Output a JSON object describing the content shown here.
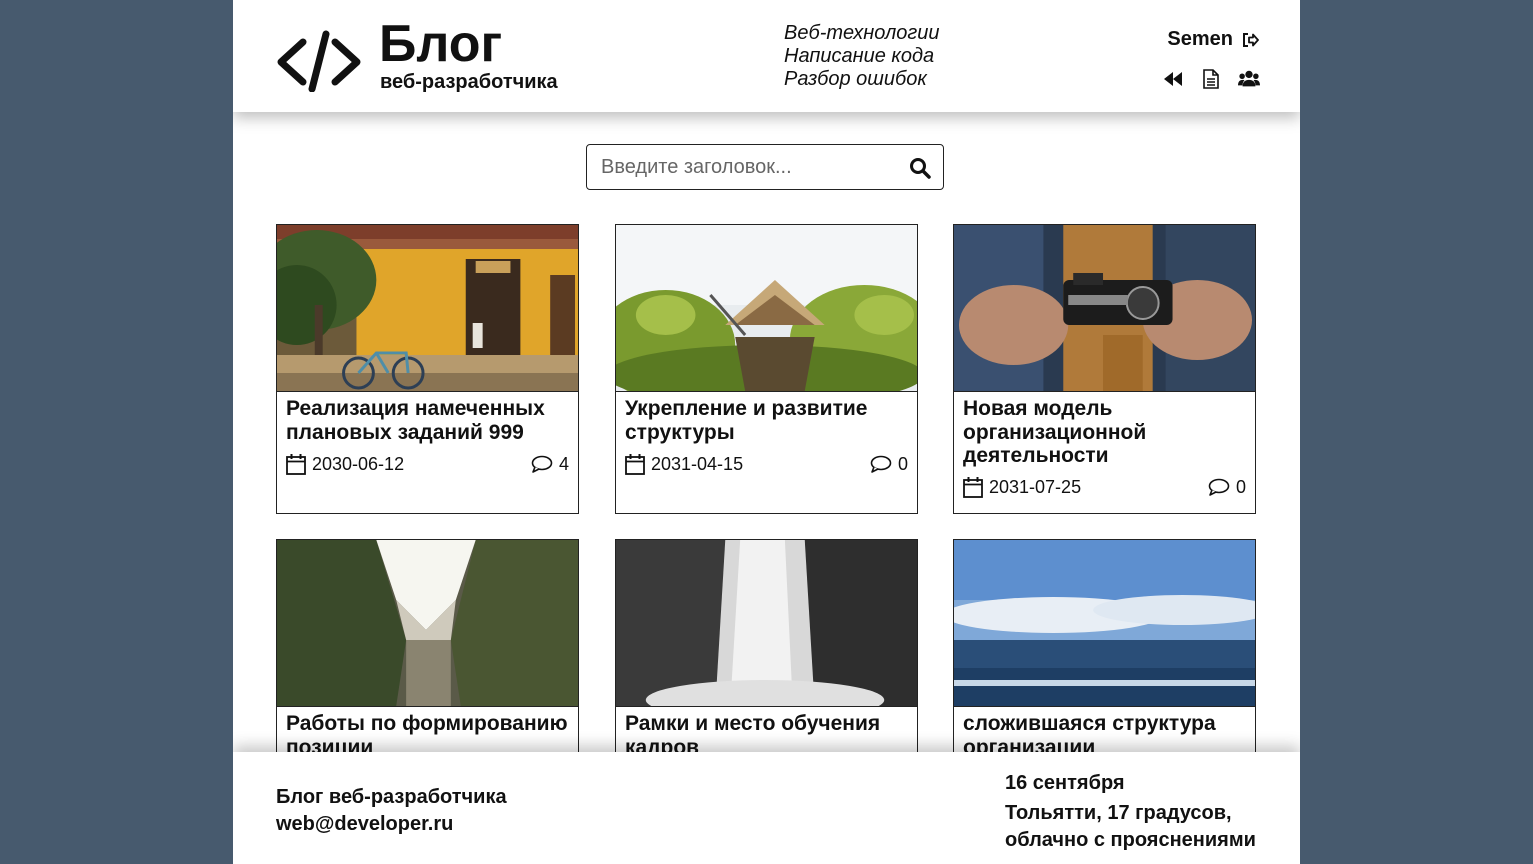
{
  "header": {
    "logo_symbol": "</>",
    "title": "Блог",
    "subtitle": "веб-разработчика",
    "nav": [
      "Веб-технологии",
      "Написание кода",
      "Разбор ошибок"
    ],
    "user_name": "Semen",
    "icons": [
      "logout-icon",
      "backward-icon",
      "document-icon",
      "users-icon"
    ]
  },
  "search": {
    "placeholder": "Введите заголовок...",
    "value": ""
  },
  "posts": [
    {
      "title": "Реализация намеченных плановых заданий 999",
      "date": "2030-06-12",
      "comments": "4",
      "image": "yellow-house-bicycle"
    },
    {
      "title": "Укрепление и развитие структуры",
      "date": "2031-04-15",
      "comments": "0",
      "image": "canoe-trees"
    },
    {
      "title": "Новая модель организационной деятельности",
      "date": "2031-07-25",
      "comments": "0",
      "image": "hands-camera"
    },
    {
      "title": "Работы по формированию позиции",
      "date": "",
      "comments": "",
      "image": "building-sky"
    },
    {
      "title": "Рамки и место обучения кадров",
      "date": "",
      "comments": "",
      "image": "waterfall"
    },
    {
      "title": "сложившаяся структура организации",
      "date": "",
      "comments": "",
      "image": "sea-sky"
    }
  ],
  "footer": {
    "blog_name": "Блог веб-разработчика",
    "email": "web@developer.ru",
    "date": "16 сентября",
    "weather_line1": "Тольятти, 17 градусов,",
    "weather_line2": "облачно с прояснениями"
  },
  "colors": {
    "background": "#475a6e",
    "page": "#ffffff",
    "text": "#111111",
    "border": "#222222"
  }
}
